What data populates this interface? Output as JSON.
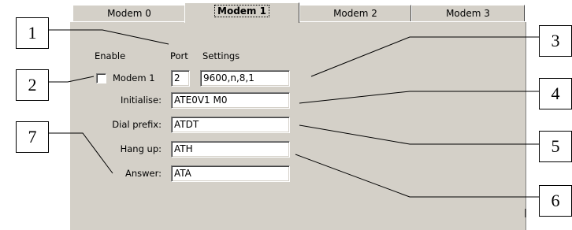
{
  "tabs": [
    {
      "label": "Modem 0",
      "active": false
    },
    {
      "label": "Modem 1",
      "active": true
    },
    {
      "label": "Modem 2",
      "active": false
    },
    {
      "label": "Modem 3",
      "active": false
    }
  ],
  "headers": {
    "enable": "Enable",
    "port": "Port",
    "settings": "Settings"
  },
  "modem": {
    "checkbox_label": "Modem 1",
    "checked": false,
    "port": "2",
    "settings": "9600,n,8,1"
  },
  "fields": {
    "initialise": {
      "label": "Initialise:",
      "value": "ATE0V1 M0"
    },
    "dial_prefix": {
      "label": "Dial prefix:",
      "value": "ATDT"
    },
    "hang_up": {
      "label": "Hang up:",
      "value": "ATH"
    },
    "answer": {
      "label": "Answer:",
      "value": "ATA"
    }
  },
  "callouts": [
    "1",
    "2",
    "3",
    "4",
    "5",
    "6",
    "7"
  ]
}
